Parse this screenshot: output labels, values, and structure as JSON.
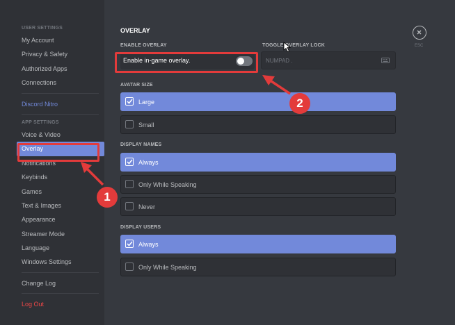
{
  "sidebar": {
    "user_settings_header": "USER SETTINGS",
    "user_items": [
      "My Account",
      "Privacy & Safety",
      "Authorized Apps",
      "Connections"
    ],
    "nitro": "Discord Nitro",
    "app_settings_header": "APP SETTINGS",
    "app_items": [
      "Voice & Video",
      "Overlay",
      "Notifications",
      "Keybinds",
      "Games",
      "Text & Images",
      "Appearance",
      "Streamer Mode",
      "Language",
      "Windows Settings"
    ],
    "selected_item": "Overlay",
    "change_log": "Change Log",
    "log_out": "Log Out"
  },
  "main": {
    "title": "OVERLAY",
    "enable_header": "ENABLE OVERLAY",
    "enable_label": "Enable in-game overlay.",
    "enable_state": false,
    "toggle_lock_header": "TOGGLE OVERLAY LOCK",
    "keybind_value": "NUMPAD .",
    "avatar_size": {
      "header": "AVATAR SIZE",
      "options": [
        {
          "label": "Large",
          "checked": true
        },
        {
          "label": "Small",
          "checked": false
        }
      ]
    },
    "display_names": {
      "header": "DISPLAY NAMES",
      "options": [
        {
          "label": "Always",
          "checked": true
        },
        {
          "label": "Only While Speaking",
          "checked": false
        },
        {
          "label": "Never",
          "checked": false
        }
      ]
    },
    "display_users": {
      "header": "DISPLAY USERS",
      "options": [
        {
          "label": "Always",
          "checked": true
        },
        {
          "label": "Only While Speaking",
          "checked": false
        }
      ]
    },
    "esc_label": "ESC"
  },
  "annotations": {
    "step1": "1",
    "step2": "2",
    "color": "#e33b3b"
  },
  "colors": {
    "accent": "#7289da",
    "sidebar_bg": "#2f3136",
    "main_bg": "#36393f",
    "danger": "#f04747"
  }
}
